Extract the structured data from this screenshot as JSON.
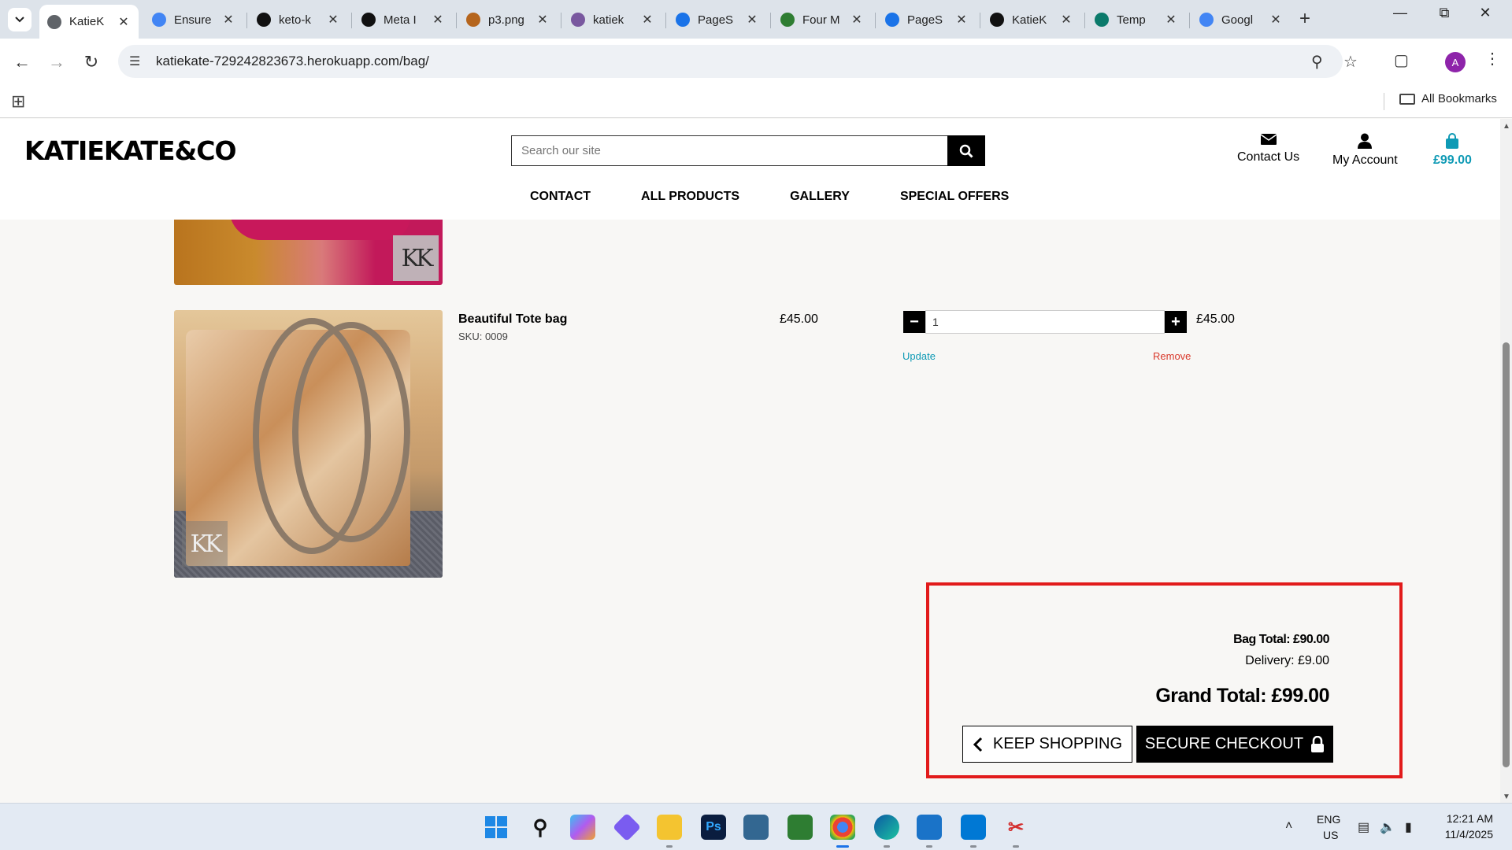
{
  "browser": {
    "tabs": [
      {
        "title": "KatieK",
        "favicon": "globe-icon",
        "color": "#5f6368",
        "active": true
      },
      {
        "title": "Ensure",
        "favicon": "chrome-icon",
        "color": "#4285f4"
      },
      {
        "title": "keto-k",
        "favicon": "github-icon",
        "color": "#111111"
      },
      {
        "title": "Meta I",
        "favicon": "openai-icon",
        "color": "#111111"
      },
      {
        "title": "p3.png",
        "favicon": "image-icon",
        "color": "#b5651d"
      },
      {
        "title": "katiek",
        "favicon": "heroku-icon",
        "color": "#79589f"
      },
      {
        "title": "PageS",
        "favicon": "pagespeed-icon",
        "color": "#1a73e8"
      },
      {
        "title": "Four M",
        "favicon": "map-icon",
        "color": "#2e7d32"
      },
      {
        "title": "PageS",
        "favicon": "pagespeed-icon",
        "color": "#1a73e8"
      },
      {
        "title": "KatieK",
        "favicon": "github-icon",
        "color": "#111111"
      },
      {
        "title": "Temp",
        "favicon": "temp-icon",
        "color": "#0b7a6b"
      },
      {
        "title": "Googl",
        "favicon": "google-icon",
        "color": "#4285f4"
      }
    ],
    "url": "katiekate-729242823673.herokuapp.com/bag/",
    "all_bookmarks": "All Bookmarks",
    "profile_initial": "A"
  },
  "site": {
    "logo": "KATIEKATE&CO",
    "search_placeholder": "Search our site",
    "contact_label": "Contact Us",
    "account_label": "My Account",
    "bag_total": "£99.00",
    "nav": [
      "CONTACT",
      "ALL PRODUCTS",
      "GALLERY",
      "SPECIAL OFFERS"
    ]
  },
  "bag": {
    "items": [
      {
        "name": "Beautiful Tote bag",
        "sku": "SKU: 0009",
        "price": "£45.00",
        "quantity": "1",
        "subtotal": "£45.00",
        "update_label": "Update",
        "remove_label": "Remove"
      }
    ],
    "bag_total": "Bag Total: £90.00",
    "delivery": "Delivery: £9.00",
    "grand_total": "Grand Total: £99.00",
    "keep_shopping": "KEEP SHOPPING",
    "secure_checkout": "SECURE CHECKOUT",
    "highlight_color": "#e21b1b"
  },
  "taskbar": {
    "language": "ENG",
    "region": "US",
    "time": "12:21 AM",
    "date": "11/4/2025"
  }
}
